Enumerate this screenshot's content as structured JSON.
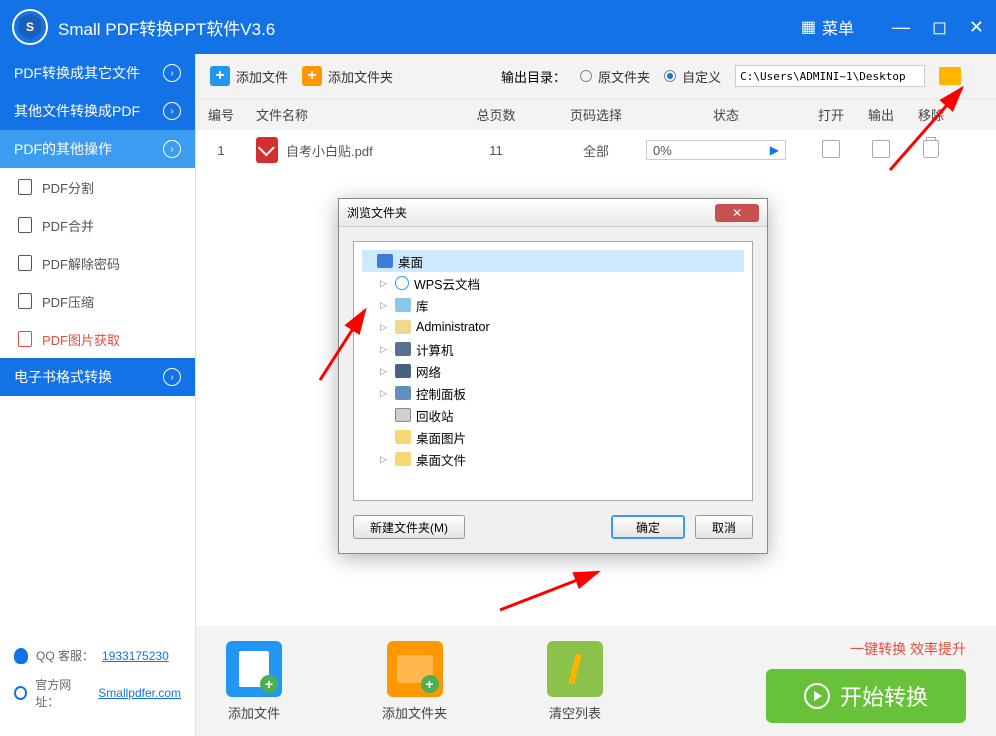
{
  "titlebar": {
    "title": "Small  PDF转换PPT软件V3.6",
    "menu": "菜单"
  },
  "sidebar": {
    "groups": [
      {
        "label": "PDF转换成其它文件"
      },
      {
        "label": "其他文件转换成PDF"
      },
      {
        "label": "PDF的其他操作"
      },
      {
        "label": "电子书格式转换"
      }
    ],
    "ops": [
      {
        "label": "PDF分割"
      },
      {
        "label": "PDF合并"
      },
      {
        "label": "PDF解除密码"
      },
      {
        "label": "PDF压缩"
      },
      {
        "label": "PDF图片获取"
      }
    ],
    "footer": {
      "qq_label": "QQ 客服：",
      "qq": "1933175230",
      "site_label": "官方网址：",
      "site": "Smallpdfer.com"
    }
  },
  "toolbar": {
    "add_file": "添加文件",
    "add_folder": "添加文件夹",
    "output_label": "输出目录：",
    "radio_orig": "原文件夹",
    "radio_custom": "自定义",
    "path": "C:\\Users\\ADMINI~1\\Desktop"
  },
  "table": {
    "headers": {
      "num": "编号",
      "name": "文件名称",
      "pages": "总页数",
      "sel": "页码选择",
      "status": "状态",
      "open": "打开",
      "out": "输出",
      "del": "移除"
    },
    "rows": [
      {
        "num": "1",
        "name": "自考小白贴.pdf",
        "pages": "11",
        "sel": "全部",
        "status": "0%"
      }
    ]
  },
  "dialog": {
    "title": "浏览文件夹",
    "tree": [
      {
        "label": "桌面",
        "icon": "ic-desktop",
        "sel": true
      },
      {
        "label": "WPS云文档",
        "icon": "ic-cloud",
        "sub": true,
        "tri": true
      },
      {
        "label": "库",
        "icon": "ic-lib",
        "sub": true,
        "tri": true
      },
      {
        "label": "Administrator",
        "icon": "ic-user",
        "sub": true,
        "tri": true
      },
      {
        "label": "计算机",
        "icon": "ic-pc",
        "sub": true,
        "tri": true
      },
      {
        "label": "网络",
        "icon": "ic-net",
        "sub": true,
        "tri": true
      },
      {
        "label": "控制面板",
        "icon": "ic-panel",
        "sub": true,
        "tri": true
      },
      {
        "label": "回收站",
        "icon": "ic-bin",
        "sub": true
      },
      {
        "label": "桌面图片",
        "icon": "ic-folder",
        "sub": true
      },
      {
        "label": "桌面文件",
        "icon": "ic-folder",
        "sub": true,
        "tri": true
      }
    ],
    "new_folder": "新建文件夹(M)",
    "ok": "确定",
    "cancel": "取消"
  },
  "bottom": {
    "add_file": "添加文件",
    "add_folder": "添加文件夹",
    "clear": "清空列表",
    "tag": "一键转换  效率提升",
    "start": "开始转换"
  }
}
